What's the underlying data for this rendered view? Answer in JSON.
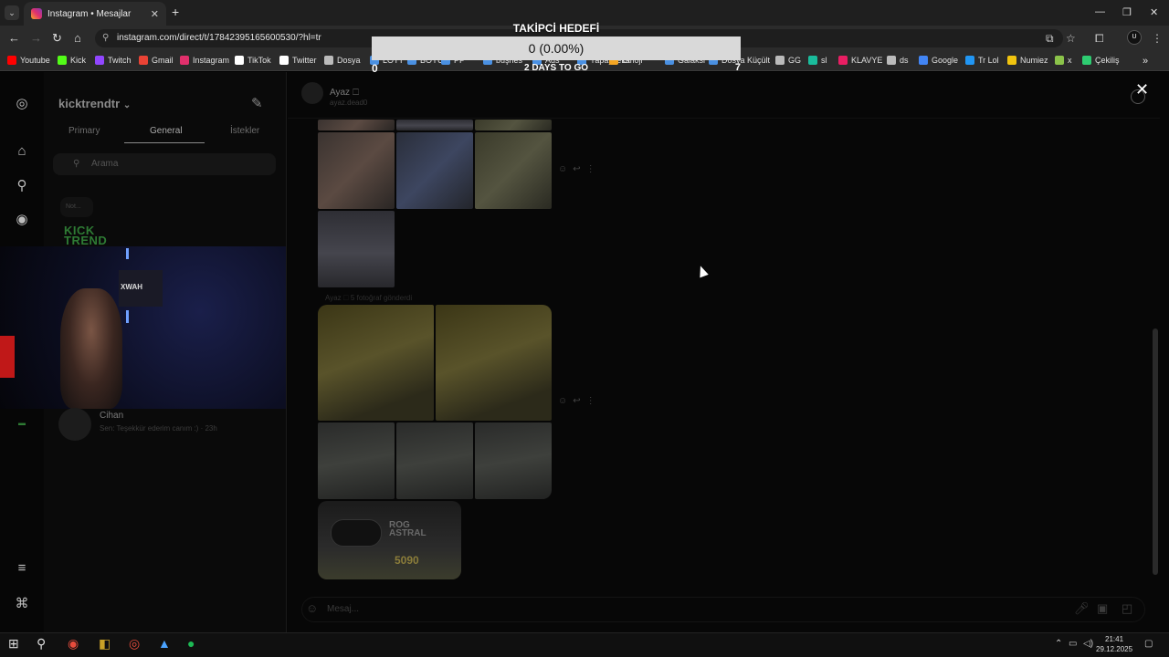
{
  "browser": {
    "tab_title": "Instagram • Mesajlar",
    "tab_close": "✕",
    "new_tab": "+",
    "url": "instagram.com/direct/t/17842395165600530/?hl=tr",
    "window_controls": [
      "—",
      "❐",
      "✕"
    ]
  },
  "bookmarks": [
    {
      "label": "Youtube",
      "color": "#ff0000"
    },
    {
      "label": "Kick",
      "color": "#53fc18"
    },
    {
      "label": "Twitch",
      "color": "#9146ff"
    },
    {
      "label": "Gmail",
      "color": "#ea4335"
    },
    {
      "label": "Instagram",
      "color": "#e1306c"
    },
    {
      "label": "TikTok",
      "color": "#ffffff"
    },
    {
      "label": "Twitter",
      "color": "#ffffff"
    },
    {
      "label": "Dosya",
      "color": "#bbbbbb"
    },
    {
      "label": "LOTT",
      "color": "#4a90e2"
    },
    {
      "label": "BOYUT",
      "color": "#4a90e2"
    },
    {
      "label": "PP",
      "color": "#4a90e2"
    },
    {
      "label": "büşhes",
      "color": "#4a90e2"
    },
    {
      "label": "Ads",
      "color": "#4a90e2"
    },
    {
      "label": "Yapayzeka",
      "color": "#4a90e2"
    },
    {
      "label": "Emoji",
      "color": "#f5a623"
    },
    {
      "label": "Galaksi",
      "color": "#4a90e2"
    },
    {
      "label": "Dosya Küçült",
      "color": "#4a90e2"
    },
    {
      "label": "GG",
      "color": "#bbbbbb"
    },
    {
      "label": "sl",
      "color": "#1abc9c"
    },
    {
      "label": "KLAVYE",
      "color": "#e91e63"
    },
    {
      "label": "ds",
      "color": "#bbbbbb"
    },
    {
      "label": "Google",
      "color": "#4285f4"
    },
    {
      "label": "Tr Lol",
      "color": "#2196f3"
    },
    {
      "label": "Numiez",
      "color": "#f1c40f"
    },
    {
      "label": "x",
      "color": "#8bc34a"
    },
    {
      "label": "Çekiliş",
      "color": "#2ecc71"
    }
  ],
  "overlay": {
    "title": "TAKİPCİ HEDEFİ",
    "value": "0 (0.00%)",
    "left": "0",
    "middle": "2 DAYS TO GO",
    "right": "7"
  },
  "sidebar": {
    "account": "kicktrendtr",
    "account_chevron": "⌄",
    "tabs": [
      "Primary",
      "General",
      "İstekler"
    ],
    "search_placeholder": "Arama",
    "note": "Not...",
    "kick_logo_line1": "KICK",
    "kick_logo_line2": "TREND",
    "cam_wall_text": "XWAH",
    "conversation": {
      "name": "Cihan",
      "preview": "Sen: Teşekkür ederim canım :) · 23h"
    }
  },
  "chat": {
    "name": "Ayaz 🗆",
    "username": "ayaz.dead0",
    "sent_meta": "Ayaz 🗆 5 fotoğraf gönderdi",
    "gpu_text_1": "ROG",
    "gpu_text_2": "ASTRAL",
    "gpu_model": "5090",
    "composer_placeholder": "Mesaj..."
  },
  "taskbar": {
    "time": "21:41",
    "date": "29.12.2025"
  },
  "colors": {
    "instagram_gradient": [
      "#f9a826",
      "#e1306c",
      "#833ab4"
    ],
    "kick_green": "#2e7b34",
    "spotify": "#1db954"
  }
}
